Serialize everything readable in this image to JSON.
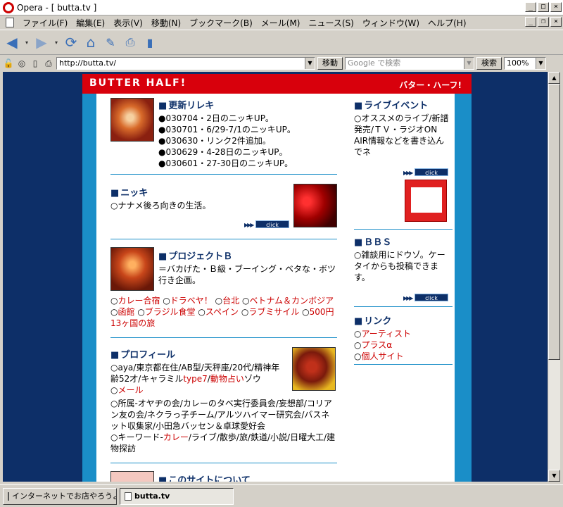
{
  "window": {
    "title": "Opera - [ butta.tv ]"
  },
  "menu": [
    "ファイル(F)",
    "編集(E)",
    "表示(V)",
    "移動(N)",
    "ブックマーク(B)",
    "メール(M)",
    "ニュース(S)",
    "ウィンドウ(W)",
    "ヘルプ(H)"
  ],
  "address": {
    "url": "http://butta.tv/",
    "go_label": "移動",
    "search_placeholder": "Google で検索",
    "search_label": "検索",
    "zoom": "100%"
  },
  "tabs": [
    "インターネットでお店やろうよ...",
    "butta.tv"
  ],
  "site": {
    "title_en": "BUTTER HALF!",
    "title_jp": "バター・ハーフ!",
    "click": "click",
    "update": {
      "heading": "更新リレキ",
      "items": [
        "●030704・2日のニッキUP。",
        "●030701・6/29-7/1のニッキUP。",
        "●030630・リンク2件追加。",
        "●030629・4-28日のニッキUP。",
        "●030601・27-30日のニッキUP。"
      ]
    },
    "nikki": {
      "heading": "ニッキ",
      "text": "○ナナメ後ろ向きの生活。"
    },
    "project": {
      "heading": "プロジェクトＢ",
      "desc": "＝バカげた・Ｂ級・ブーイング・ベタな・ボツ行き企画。",
      "links": [
        "カレー合宿",
        "ドラベヤ！",
        "台北",
        "ベトナム＆カンボジア",
        "函館",
        "ブラジル食堂",
        "スペイン",
        "ラブミサイル",
        "500円13ヶ国の旅"
      ]
    },
    "profile": {
      "heading": "プロフィール",
      "line1": "○aya/東京都在住/AB型/天秤座/20代/精神年齢52才/キャラミル",
      "type7": "type7",
      "slash": "/",
      "uranai": "動物占い",
      "zou": "ゾウ",
      "mail": "メール",
      "line2": "○所属-オヤヂの会/カレーのタベ実行委員会/妄想部/コリアン友の会/ネクラっ子チーム/アルツハイマー研究会/バスネット収集家/小田急バッセン＆卓球愛好会",
      "kw": "○キーワード-",
      "curry": "カレー",
      "kw_rest": "/ライブ/散歩/旅/鉄道/小説/日曜大工/建物探訪"
    },
    "about": {
      "heading": "このサイトについて"
    },
    "live": {
      "heading": "ライブイベント",
      "text": "○オススメのライブ/新譜発売/ＴＶ・ラジオON AIR情報などを書き込んでネ"
    },
    "bbs": {
      "heading": "ＢＢＳ",
      "text": "○雑談用にドウゾ。ケータイからも投稿できます。"
    },
    "link": {
      "heading": "リンク",
      "items": [
        "アーティスト",
        "プラスα",
        "個人サイト"
      ]
    }
  }
}
